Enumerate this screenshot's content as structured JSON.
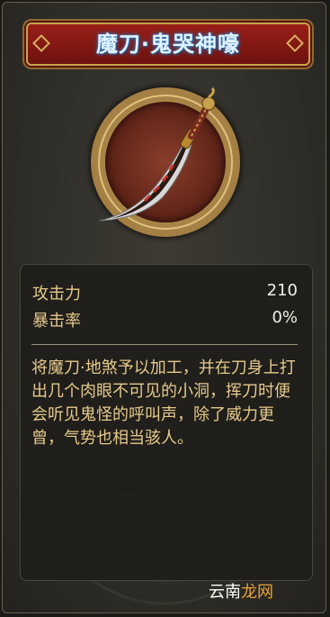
{
  "item": {
    "name": "魔刀·鬼哭神嚎",
    "icon": "demon-saber-icon"
  },
  "stats": [
    {
      "label": "攻击力",
      "value": "210"
    },
    {
      "label": "暴击率",
      "value": "0%"
    }
  ],
  "description": "将魔刀·地煞予以加工，并在刀身上打出几个肉眼不可见的小洞，挥刀时便会听见鬼怪的呼叫声，除了威力更曾，气势也相当骇人。",
  "watermark": {
    "text_main": "云南",
    "text_accent": "龙网"
  },
  "colors": {
    "title_bg": "#8a1a14",
    "title_text": "#dff2ff",
    "label": "#e6c98b",
    "value": "#f2efe6",
    "gold_border": "#c9a24f"
  }
}
